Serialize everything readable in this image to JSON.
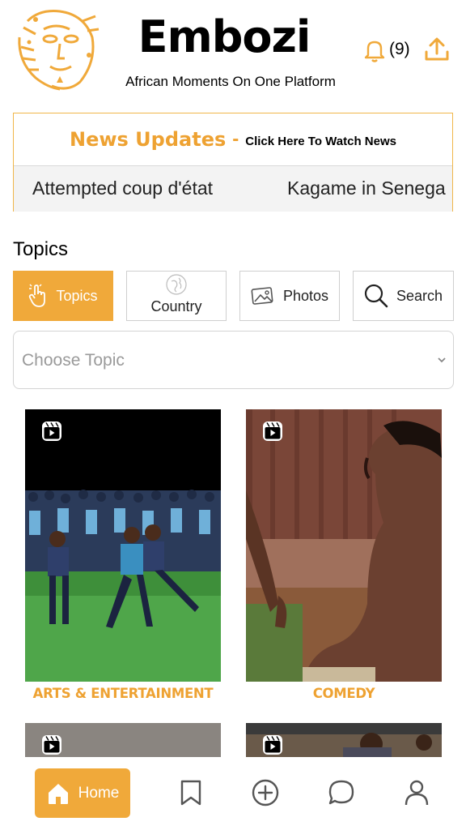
{
  "header": {
    "title": "Embozi",
    "tagline": "African Moments On One Platform",
    "notification_count": "(9)",
    "icons": [
      "logo-mask-icon",
      "bell-icon",
      "upload-icon"
    ]
  },
  "news": {
    "title": "News Updates",
    "dash": "-",
    "link": "Click Here To Watch News",
    "ticker": [
      "Attempted coup d'état",
      "Kagame in Senega"
    ]
  },
  "topics": {
    "heading": "Topics",
    "tabs": [
      {
        "label": "Topics",
        "icon": "tap-hand-icon",
        "active": true
      },
      {
        "label": "Country",
        "icon": "globe-icon",
        "active": false
      },
      {
        "label": "Photos",
        "icon": "photo-icon",
        "active": false
      },
      {
        "label": "Search",
        "icon": "search-icon",
        "active": false
      }
    ],
    "select_placeholder": "Choose Topic"
  },
  "cards": [
    {
      "label": "ARTS & ENTERTAINMENT",
      "icon": "reel-icon"
    },
    {
      "label": "COMEDY",
      "icon": "reel-icon"
    }
  ],
  "bottom_nav": {
    "home_label": "Home",
    "items": [
      "home-icon",
      "bookmark-icon",
      "add-circle-icon",
      "chat-icon",
      "profile-icon"
    ]
  },
  "colors": {
    "accent": "#f0a93a",
    "accent_text": "#eea232",
    "border": "#cfcfcf"
  }
}
